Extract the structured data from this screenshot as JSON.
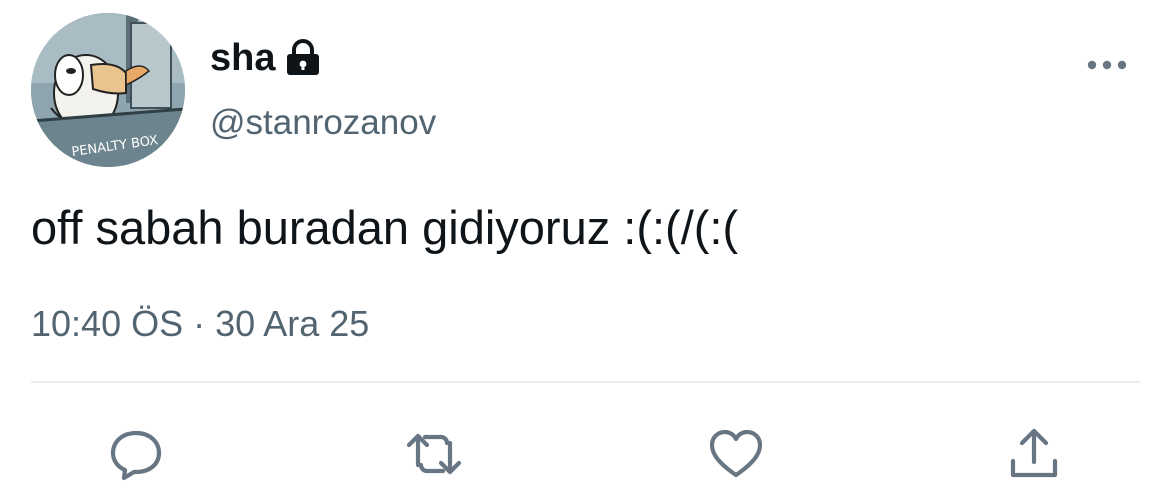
{
  "author": {
    "display_name": "sha",
    "handle": "@stanrozanov",
    "avatar_caption": "PENALTY BOX",
    "protected_icon": "lock-icon"
  },
  "tweet": {
    "text": "off sabah buradan gidiyoruz :(:(/(:(",
    "time": "10:40 ÖS",
    "separator": "·",
    "date": "30 Ara 25"
  },
  "actions": [
    {
      "name": "reply",
      "icon": "reply-icon"
    },
    {
      "name": "retweet",
      "icon": "retweet-icon"
    },
    {
      "name": "like",
      "icon": "heart-icon"
    },
    {
      "name": "share",
      "icon": "share-icon"
    }
  ],
  "colors": {
    "text": "#0f1419",
    "secondary": "#536471",
    "divider": "#e6ecf0",
    "icon": "#687684"
  }
}
